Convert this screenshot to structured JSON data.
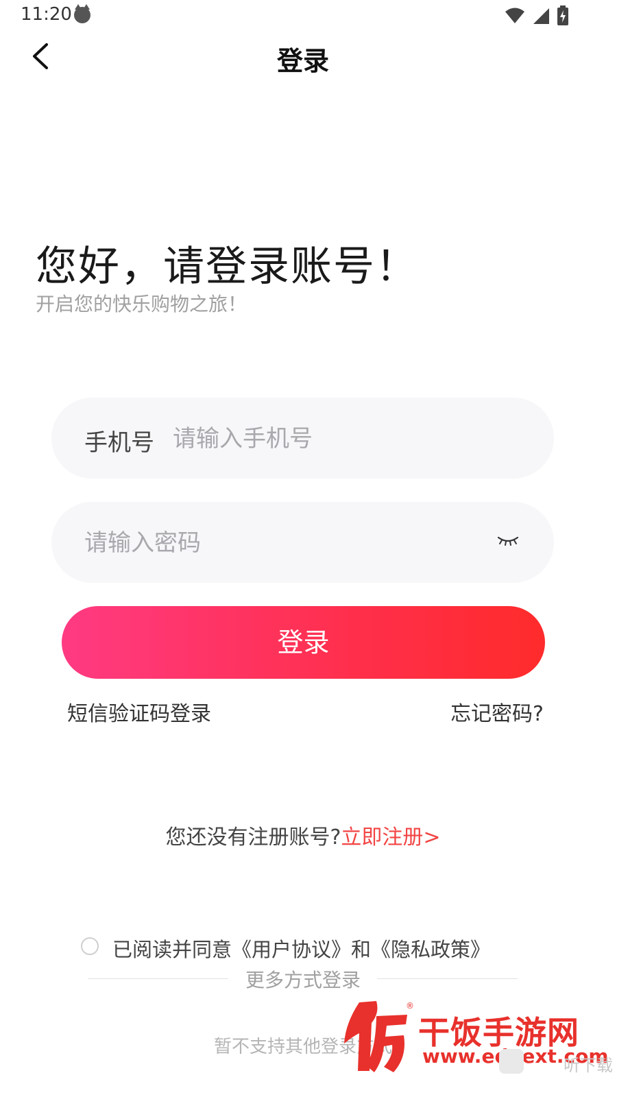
{
  "status_bar": {
    "time": "11:20"
  },
  "header": {
    "title": "登录"
  },
  "greeting": {
    "title": "您好，请登录账号！",
    "subtitle": "开启您的快乐购物之旅！"
  },
  "form": {
    "phone_label": "手机号",
    "phone_placeholder": "请输入手机号",
    "password_placeholder": "请输入密码",
    "login_button": "登录",
    "sms_login": "短信验证码登录",
    "forgot_password": "忘记密码?"
  },
  "register": {
    "question": "您还没有注册账号?",
    "link": "立即注册>"
  },
  "agreement": {
    "text": "已阅读并同意《用户协议》和《隐私政策》"
  },
  "more_login": {
    "label": "更多方式登录",
    "unsupported": "暂不支持其他登录方式"
  },
  "watermark": {
    "brand": "干饭手游网",
    "url": "www.eduext.com",
    "corner": "听下载"
  },
  "colors": {
    "accent_start": "#ff3a82",
    "accent_end": "#ff2b2b",
    "link_red": "#f24444"
  }
}
